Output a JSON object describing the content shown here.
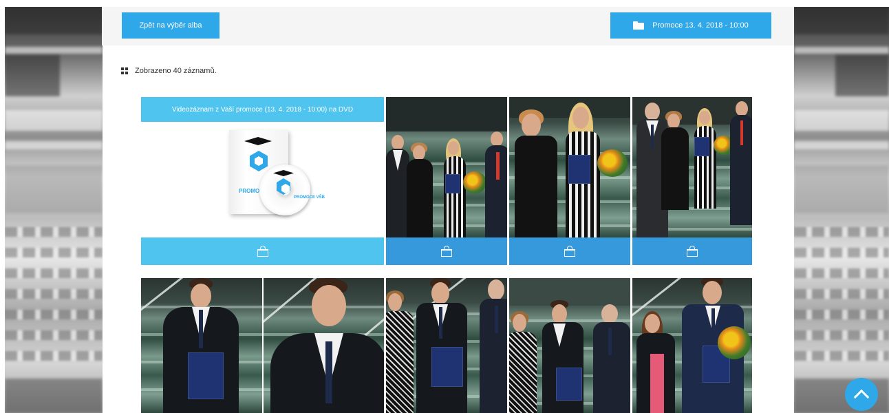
{
  "toolbar": {
    "back_label": "Zpět na výběr alba",
    "event_label": "Promoce 13. 4. 2018 - 10:00",
    "event_icon": "folder-icon"
  },
  "gallery": {
    "count_text": "Zobrazeno 40 záznamů.",
    "count_icon": "grid-icon",
    "product": {
      "banner": "Videozáznam z Vaší promoce (13. 4. 2018 - 10:00) na DVD",
      "case_text": "PROMOCE VŠB",
      "disc_text": "PROMOCE VŠB"
    },
    "cart_icon": "shopping-bag-icon"
  },
  "colors": {
    "accent": "#2ea8e8",
    "cart_dark": "#3599dc",
    "cart_light": "#4ec4ef"
  },
  "scroll_top_icon": "chevron-up-icon"
}
